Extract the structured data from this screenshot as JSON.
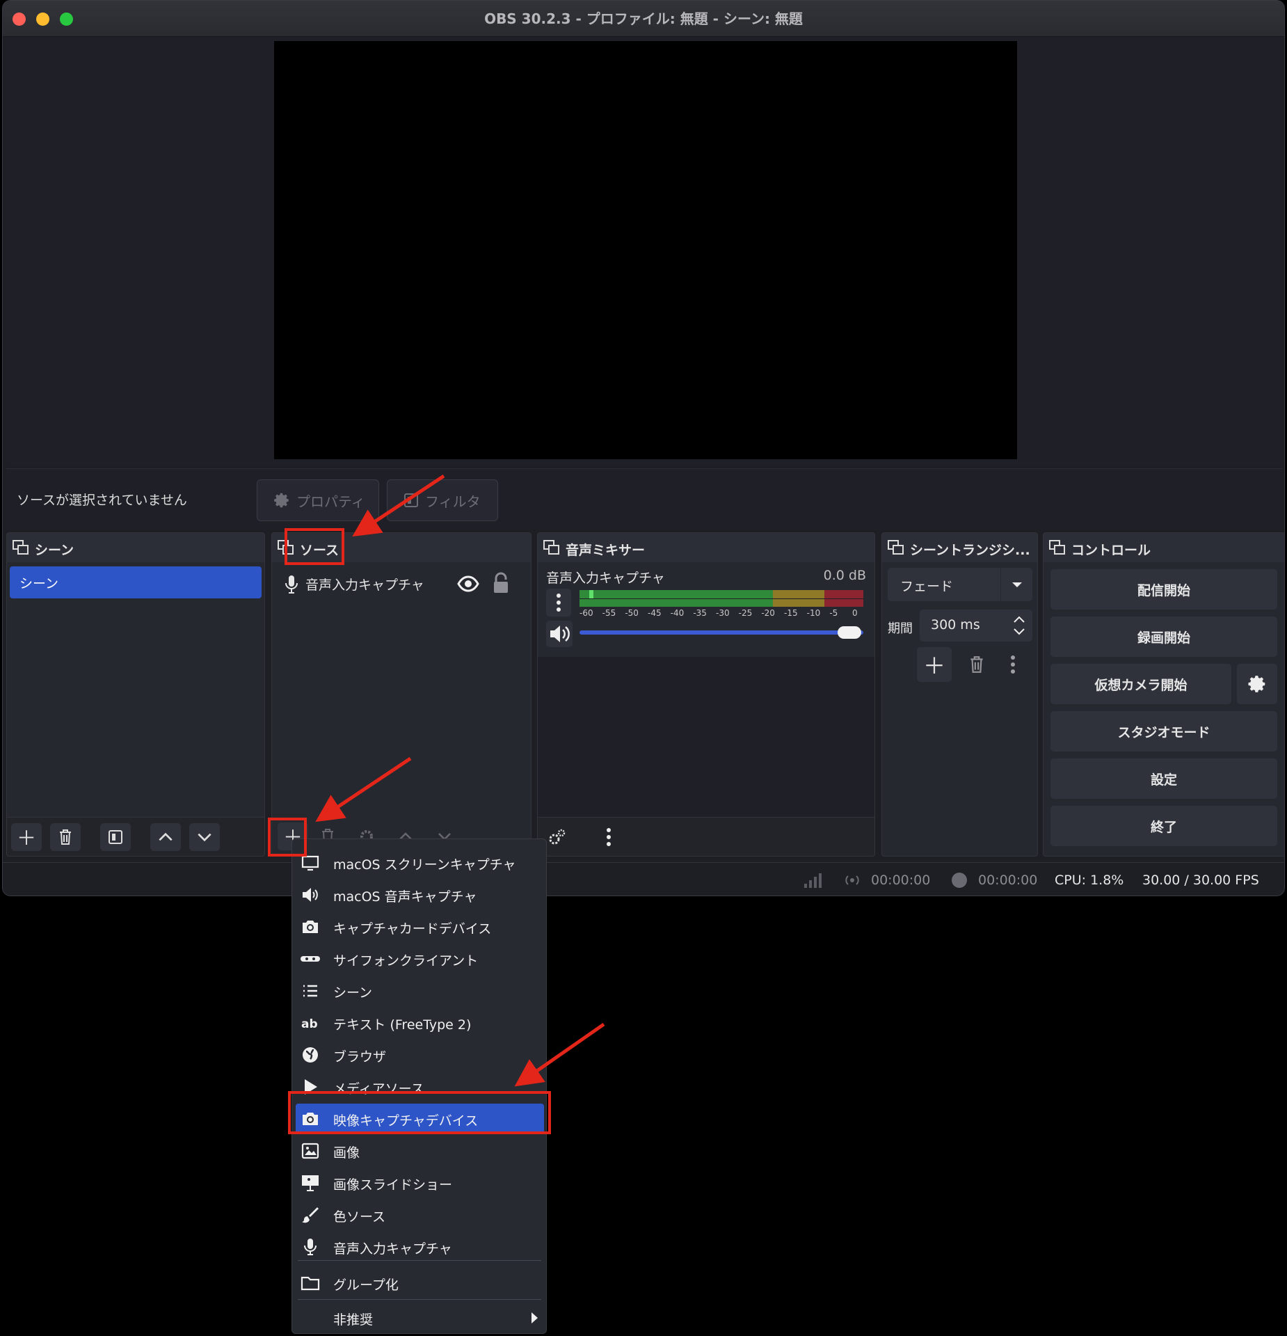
{
  "window": {
    "title": "OBS 30.2.3 - プロファイル: 無題 - シーン: 無題"
  },
  "source_toolbar": {
    "no_source": "ソースが選択されていません",
    "properties": "プロパティ",
    "filters": "フィルタ"
  },
  "scenes": {
    "title": "シーン",
    "items": [
      "シーン"
    ]
  },
  "sources": {
    "title": "ソース",
    "items": [
      "音声入力キャプチャ"
    ]
  },
  "mixer": {
    "title": "音声ミキサー",
    "channel_name": "音声入力キャプチャ",
    "channel_db": "0.0 dB",
    "ticks": [
      "-60",
      "-55",
      "-50",
      "-45",
      "-40",
      "-35",
      "-30",
      "-25",
      "-20",
      "-15",
      "-10",
      "-5",
      "0"
    ],
    "volume_fraction": 0.95
  },
  "transitions": {
    "title": "シーントランジシ...",
    "selected": "フェード",
    "duration_label": "期間",
    "duration_value": "300 ms"
  },
  "controls": {
    "title": "コントロール",
    "start_streaming": "配信開始",
    "start_recording": "録画開始",
    "start_virtualcam": "仮想カメラ開始",
    "studio_mode": "スタジオモード",
    "settings": "設定",
    "exit": "終了"
  },
  "status": {
    "stream_time": "00:00:00",
    "record_time": "00:00:00",
    "cpu": "CPU: 1.8%",
    "fps": "30.00 / 30.00 FPS"
  },
  "context_menu": {
    "items": [
      {
        "label": "macOS スクリーンキャプチャ",
        "icon": "monitor-icon"
      },
      {
        "label": "macOS 音声キャプチャ",
        "icon": "speaker-icon"
      },
      {
        "label": "キャプチャカードデバイス",
        "icon": "camera-icon"
      },
      {
        "label": "サイフォンクライアント",
        "icon": "gamepad-icon"
      },
      {
        "label": "シーン",
        "icon": "list-icon"
      },
      {
        "label": "テキスト (FreeType 2)",
        "icon": "text-icon"
      },
      {
        "label": "ブラウザ",
        "icon": "globe-icon"
      },
      {
        "label": "メディアソース",
        "icon": "play-icon"
      },
      {
        "label": "映像キャプチャデバイス",
        "icon": "camera-icon"
      },
      {
        "label": "画像",
        "icon": "image-icon"
      },
      {
        "label": "画像スライドショー",
        "icon": "slideshow-icon"
      },
      {
        "label": "色ソース",
        "icon": "brush-icon"
      },
      {
        "label": "音声入力キャプチャ",
        "icon": "microphone-icon"
      }
    ],
    "group": "グループ化",
    "deprecated": "非推奨",
    "selected_index": 8
  },
  "colors": {
    "accent": "#2d55c8",
    "annotation_red": "#e32619",
    "meter_green": "#2f8a3a",
    "meter_yellow": "#8f7a28",
    "meter_red": "#8c2530"
  }
}
